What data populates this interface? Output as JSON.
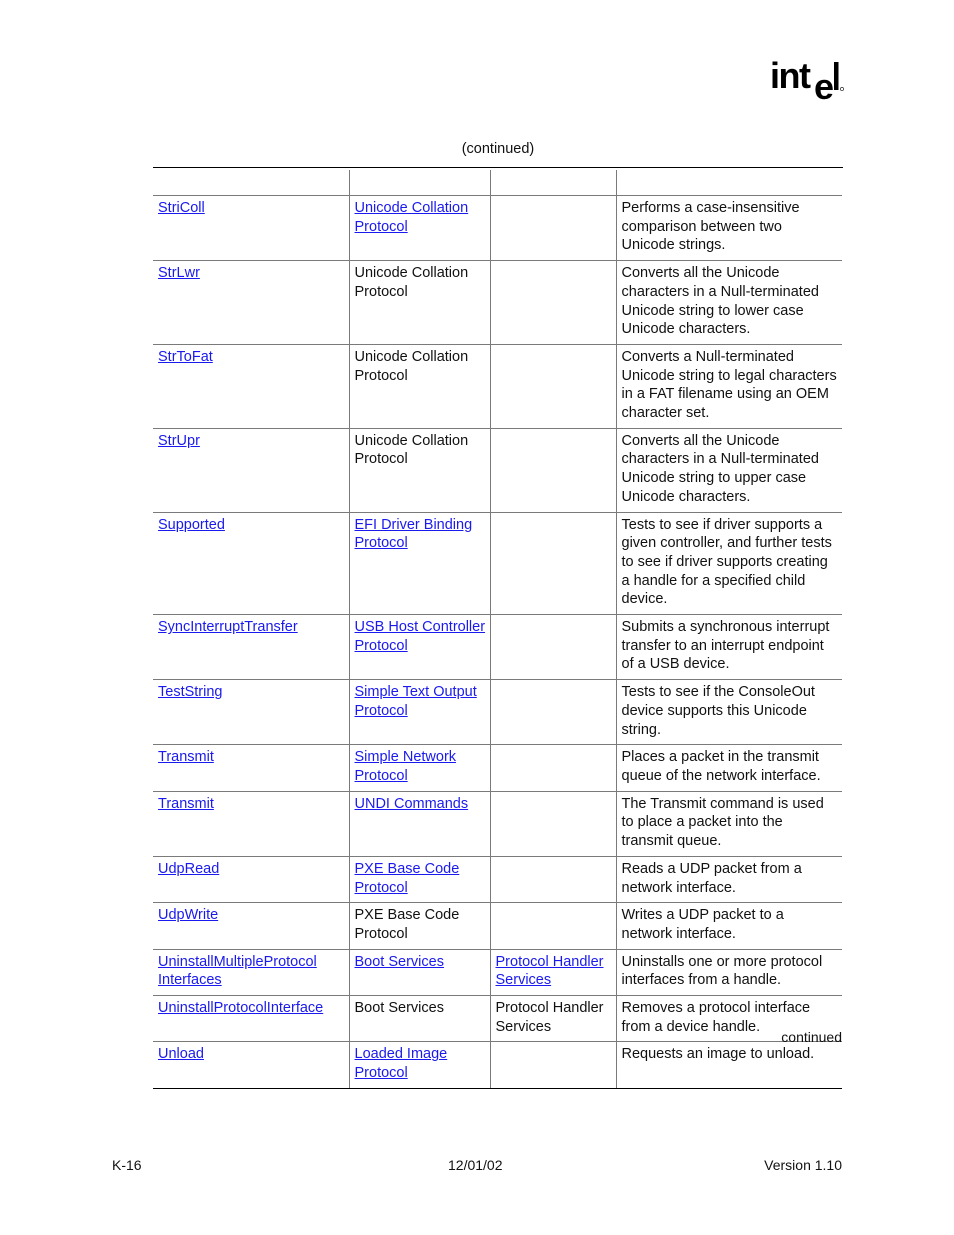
{
  "header": {
    "logo_icon": "intel-logo-icon",
    "logo_text": "intel",
    "caption": "(continued)"
  },
  "table": {
    "columns": [
      "",
      "",
      "",
      ""
    ],
    "rows": [
      {
        "name": "StriColl",
        "name_link": true,
        "protocol": "Unicode Collation Protocol",
        "protocol_link": true,
        "group": "",
        "group_link": false,
        "description": "Performs a case-insensitive comparison between two Unicode strings."
      },
      {
        "name": "StrLwr",
        "name_link": true,
        "protocol": "Unicode Collation Protocol",
        "protocol_link": false,
        "group": "",
        "group_link": false,
        "description": "Converts all the Unicode characters in a Null-terminated Unicode string to lower case Unicode characters."
      },
      {
        "name": "StrToFat",
        "name_link": true,
        "protocol": "Unicode Collation Protocol",
        "protocol_link": false,
        "group": "",
        "group_link": false,
        "description": "Converts a Null-terminated Unicode string to legal characters in a FAT filename using an OEM character set."
      },
      {
        "name": "StrUpr",
        "name_link": true,
        "protocol": "Unicode Collation Protocol",
        "protocol_link": false,
        "group": "",
        "group_link": false,
        "description": "Converts all the Unicode characters in a Null-terminated Unicode string to upper case Unicode characters."
      },
      {
        "name": "Supported",
        "name_link": true,
        "protocol": "EFI Driver Binding Protocol",
        "protocol_link": true,
        "group": "",
        "group_link": false,
        "description": "Tests to see if driver supports a given controller, and further tests to see if driver supports creating a handle for a specified child device."
      },
      {
        "name": "SyncInterruptTransfer",
        "name_link": true,
        "protocol": "USB Host Controller Protocol",
        "protocol_link": true,
        "group": "",
        "group_link": false,
        "description": "Submits a synchronous interrupt transfer to an interrupt endpoint of a USB device."
      },
      {
        "name": "TestString",
        "name_link": true,
        "protocol": "Simple Text Output Protocol",
        "protocol_link": true,
        "group": "",
        "group_link": false,
        "description": "Tests to see if the ConsoleOut device supports this Unicode string."
      },
      {
        "name": "Transmit",
        "name_link": true,
        "protocol": "Simple Network Protocol",
        "protocol_link": true,
        "group": "",
        "group_link": false,
        "description": "Places a packet in the transmit queue of the network interface."
      },
      {
        "name": "Transmit",
        "name_link": true,
        "protocol": "UNDI Commands",
        "protocol_link": true,
        "group": "",
        "group_link": false,
        "description": "The Transmit command is used to place a packet into the transmit queue."
      },
      {
        "name": "UdpRead",
        "name_link": true,
        "protocol": "PXE Base Code Protocol",
        "protocol_link": true,
        "group": "",
        "group_link": false,
        "description": "Reads a UDP packet from a network interface."
      },
      {
        "name": "UdpWrite",
        "name_link": true,
        "protocol": "PXE Base Code Protocol",
        "protocol_link": false,
        "group": "",
        "group_link": false,
        "description": "Writes a UDP packet to a network interface."
      },
      {
        "name": "UninstallMultipleProtocol Interfaces",
        "name_link": true,
        "protocol": "Boot Services",
        "protocol_link": true,
        "group": "Protocol Handler Services",
        "group_link": true,
        "description": "Uninstalls one or more protocol interfaces from a handle."
      },
      {
        "name": "UninstallProtocolInterface",
        "name_link": true,
        "protocol": "Boot Services",
        "protocol_link": false,
        "group": "Protocol Handler Services",
        "group_link": false,
        "description": "Removes a protocol interface from a device handle."
      },
      {
        "name": "Unload",
        "name_link": true,
        "protocol": "Loaded Image Protocol",
        "protocol_link": true,
        "group": "",
        "group_link": false,
        "description": "Requests an image to unload."
      }
    ]
  },
  "continued_note": "continued",
  "footer": {
    "page": "K-16",
    "date": "12/01/02",
    "version": "Version 1.10"
  },
  "colors": {
    "link": "#1a1aee",
    "text": "#111111",
    "rule": "#000000",
    "grid": "#7a7a7a"
  }
}
